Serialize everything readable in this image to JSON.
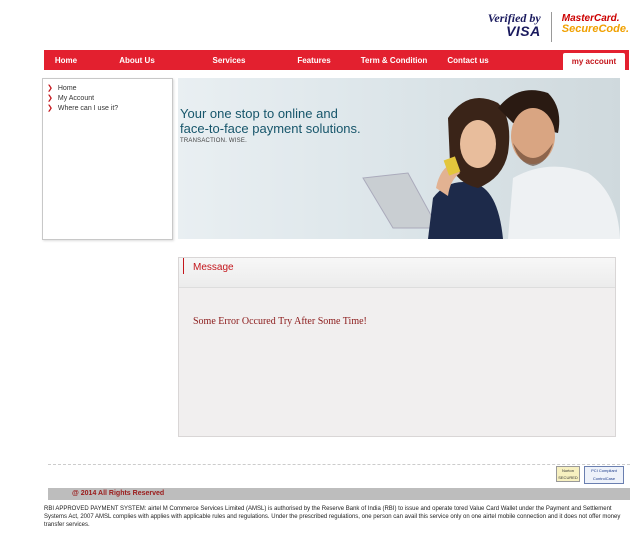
{
  "badges": {
    "vbv_line1": "Verified by",
    "vbv_line2": "VISA",
    "mc_line1": "MasterCard.",
    "mc_line2": "SecureCode."
  },
  "nav": {
    "items": [
      "Home",
      "About Us",
      "Services",
      "Features",
      "Term & Condition",
      "Contact us"
    ],
    "my_account": "my account"
  },
  "sidebar": {
    "links": [
      "Home",
      "My Account",
      "Where can I use it?"
    ]
  },
  "banner": {
    "line1": "Your one stop to online and",
    "line2": "face-to-face payment solutions.",
    "tagline": "TRANSACTION. WISE."
  },
  "message": {
    "title": "Message",
    "error": "Some Error Occured Try After Some Time!"
  },
  "seals": {
    "norton": "Norton SECURED",
    "pci_line1": "PCI Compliant",
    "pci_line2": "ControlCase"
  },
  "footer": {
    "copyright": "@ 2014 All Rights Reserved",
    "disclaimer": "RBI APPROVED PAYMENT SYSTEM: airtel M Commerce Services Limited (AMSL) is authorised by the Reserve Bank of India (RBI) to issue and operate tored Value Card Wallet under the Payment and Settlement Systems Act, 2007 AMSL complies with applies with applicable rules and regulations. Under the prescribed regulations, one person can avail this service only on one airtel mobile connection and it does not offer money transfer services."
  },
  "colors": {
    "brand_red": "#e3202f",
    "accent_teal": "#17566b"
  }
}
